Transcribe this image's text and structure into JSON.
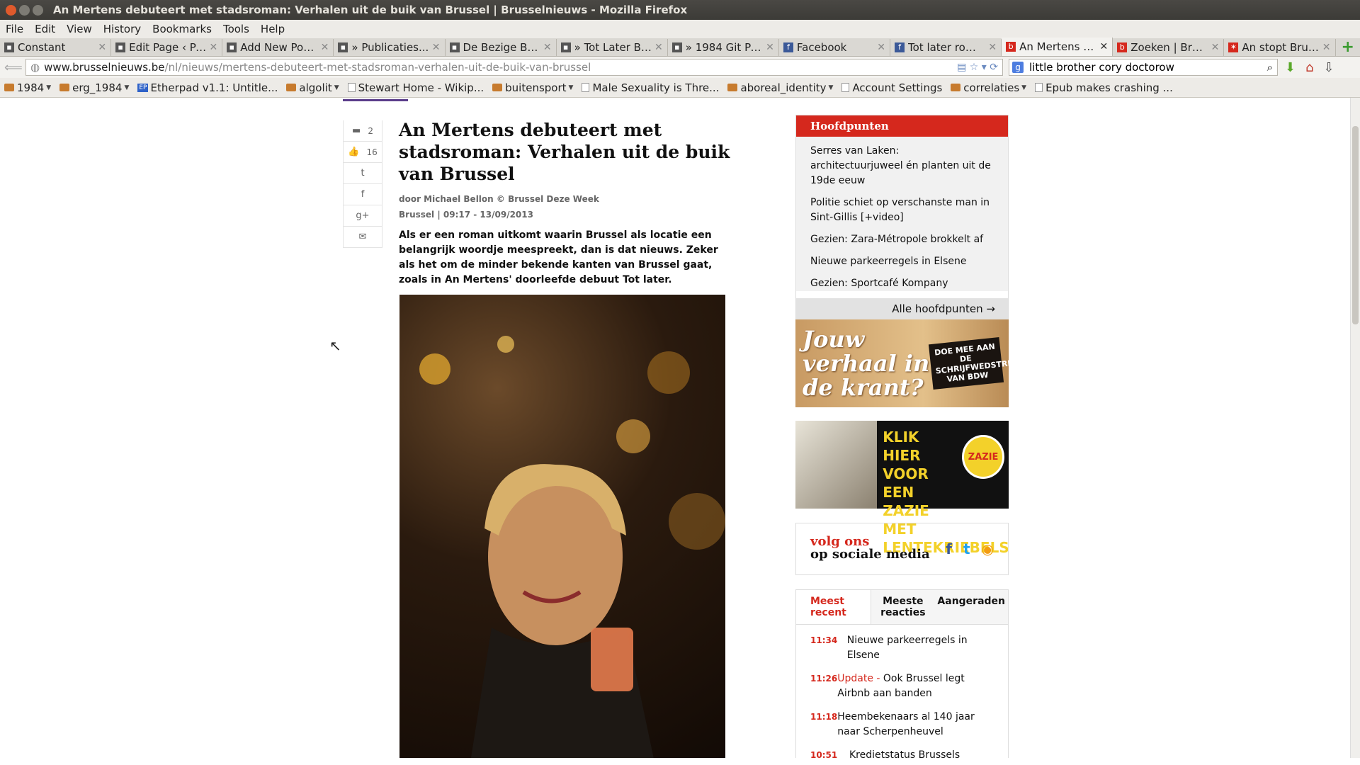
{
  "window": {
    "title": "An Mertens debuteert met stadsroman: Verhalen uit de buik van Brussel | Brusselnieuws - Mozilla Firefox"
  },
  "menu": [
    "File",
    "Edit",
    "View",
    "History",
    "Bookmarks",
    "Tools",
    "Help"
  ],
  "tabs": [
    {
      "label": "Constant",
      "icon": "page-icon"
    },
    {
      "label": "Edit Page ‹ Pa...",
      "icon": "page-icon"
    },
    {
      "label": "Add New Pos...",
      "icon": "page-icon"
    },
    {
      "label": "» Publicaties...",
      "icon": "page-icon"
    },
    {
      "label": "De Bezige Bij ...",
      "icon": "page-icon"
    },
    {
      "label": "» Tot Later BB...",
      "icon": "page-icon"
    },
    {
      "label": "» 1984 Git Par...",
      "icon": "page-icon"
    },
    {
      "label": "Facebook",
      "icon": "facebook-icon"
    },
    {
      "label": "Tot later roman",
      "icon": "facebook-icon"
    },
    {
      "label": "An Mertens d...",
      "icon": "b-icon",
      "active": true
    },
    {
      "label": "Zoeken | Brus...",
      "icon": "b-icon"
    },
    {
      "label": "An stopt Brus...",
      "icon": "star-icon"
    }
  ],
  "nav": {
    "url_host": "www.brusselnieuws.be",
    "url_path": "/nl/nieuws/mertens-debuteert-met-stadsroman-verhalen-uit-de-buik-van-brussel",
    "search_value": "little brother cory doctorow"
  },
  "bookmarks": [
    {
      "label": "1984",
      "type": "folder"
    },
    {
      "label": "erg_1984",
      "type": "folder"
    },
    {
      "label": "Etherpad v1.1: Untitle...",
      "type": "ep"
    },
    {
      "label": "algolit",
      "type": "folder"
    },
    {
      "label": "Stewart Home - Wikip...",
      "type": "page"
    },
    {
      "label": "buitensport",
      "type": "folder"
    },
    {
      "label": "Male Sexuality is Thre...",
      "type": "page"
    },
    {
      "label": "aboreal_identity",
      "type": "folder"
    },
    {
      "label": "Account Settings",
      "type": "page"
    },
    {
      "label": "correlaties",
      "type": "folder"
    },
    {
      "label": "Epub makes crashing ...",
      "type": "page"
    }
  ],
  "article": {
    "comments": "2",
    "likes": "16",
    "headline": "An Mertens debuteert met stadsroman: Verhalen uit de buik van Brussel",
    "byline": "door Michael Bellon © Brussel Deze Week",
    "dateline": "Brussel  |  09:17 - 13/09/2013",
    "lead": "Als er een roman uitkomt waarin Brussel als locatie een belangrijk woordje meespreekt, dan is dat nieuws. Zeker als het om de minder bekende kanten van Brussel gaat, zoals in An Mertens' doorleefde debuut Tot later."
  },
  "hoofdpunten": {
    "title": "Hoofdpunten",
    "items": [
      "Serres van Laken: architectuurjuweel én planten uit de 19de eeuw",
      "Politie schiet op verschanste man in Sint-Gillis [+video]",
      "Gezien: Zara-Métropole brokkelt af",
      "Nieuwe parkeerregels in Elsene",
      "Gezien: Sportcafé Kompany"
    ],
    "more": "Alle hoofdpunten →"
  },
  "ad1": {
    "script": "Jouw verhaal in de krant?",
    "stamp": "DOE MEE AAN DE SCHRIJFWEDSTRIJD VAN BDW"
  },
  "ad2": {
    "text": "KLIK HIER VOOR EEN ZAZIE MET LENTEKRIEBELS",
    "badge": "ZAZIE"
  },
  "social": {
    "line1": "volg ons",
    "line2": "op sociale media"
  },
  "newstabs": {
    "tabs": [
      "Meest recent",
      "Meeste reacties",
      "Aangeraden"
    ],
    "items": [
      {
        "time": "11:34",
        "prefix": "",
        "text": "Nieuwe parkeerregels in Elsene"
      },
      {
        "time": "11:26",
        "prefix": "Update - ",
        "text": "Ook Brussel legt Airbnb aan banden"
      },
      {
        "time": "11:18",
        "prefix": "",
        "text": "Heembekenaars al 140 jaar naar Scherpenheuvel"
      },
      {
        "time": "10:51",
        "prefix": "",
        "text": "Kredietstatus Brussels"
      }
    ]
  },
  "colors": {
    "accent": "#d5281d",
    "topline": "#5a3d8a"
  }
}
